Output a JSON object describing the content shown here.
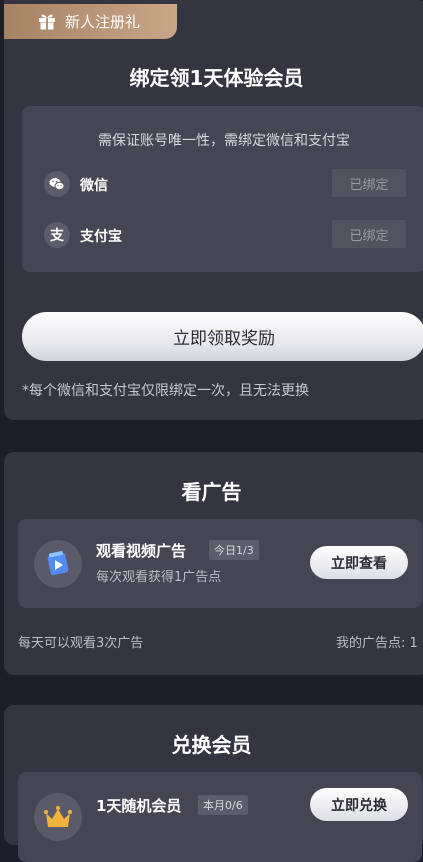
{
  "tag": {
    "label": "新人注册礼",
    "icon": "gift-icon"
  },
  "bind_section": {
    "title": "绑定领1天体验会员",
    "note": "需保证账号唯一性，需绑定微信和支付宝",
    "rows": [
      {
        "label": "微信",
        "icon": "wechat-icon",
        "status": "已绑定"
      },
      {
        "label": "支付宝",
        "icon": "alipay-icon",
        "status": "已绑定"
      }
    ],
    "claim_button": "立即领取奖励",
    "footnote": "*每个微信和支付宝仅限绑定一次，且无法更换"
  },
  "ad_section": {
    "title": "看广告",
    "task": {
      "title": "观看视频广告",
      "badge": "今日1/3",
      "desc": "每次观看获得1广告点",
      "button": "立即查看",
      "icon": "video-ad-icon"
    },
    "footer_left": "每天可以观看3次广告",
    "footer_right": "我的广告点: 1"
  },
  "vip_section": {
    "title": "兑换会员",
    "task": {
      "title": "1天随机会员",
      "badge": "本月0/6",
      "button": "立即兑换",
      "icon": "crown-icon"
    }
  },
  "colors": {
    "background": "#1c1e2a",
    "card": "#353542",
    "panel": "#454553",
    "tag_gold": "#b8957a"
  }
}
